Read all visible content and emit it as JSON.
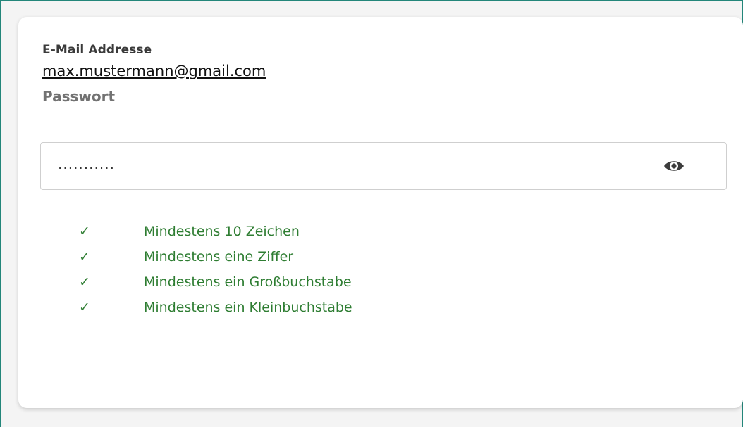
{
  "colors": {
    "frame_border": "#23867a",
    "card_bg": "#ffffff",
    "requirement_green": "#2e7d32",
    "label_dark": "#3a3a3a",
    "label_gray": "#727272"
  },
  "form": {
    "email_label": "E-Mail Addresse",
    "email_value": "max.mustermann@gmail.com",
    "password_label": "Passwort",
    "password_masked": "...........",
    "toggle_icon": "eye-icon"
  },
  "requirements": [
    {
      "check_icon": "check-icon",
      "text": "Mindestens 10 Zeichen",
      "met": true
    },
    {
      "check_icon": "check-icon",
      "text": "Mindestens eine Ziffer",
      "met": true
    },
    {
      "check_icon": "check-icon",
      "text": "Mindestens ein Großbuchstabe",
      "met": true
    },
    {
      "check_icon": "check-icon",
      "text": "Mindestens ein Kleinbuchstabe",
      "met": true
    }
  ]
}
